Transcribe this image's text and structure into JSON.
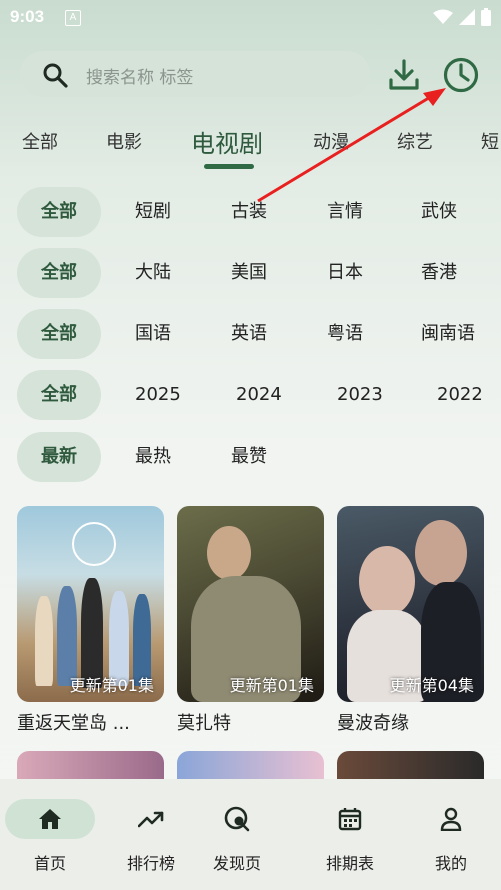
{
  "status_bar": {
    "time": "9:03",
    "notif_letter": "A"
  },
  "search": {
    "placeholder": "搜索名称 标签"
  },
  "icons": {
    "search": "search-icon",
    "download": "download-icon",
    "history": "clock-icon",
    "home": "home-icon",
    "ranking": "trending-icon",
    "discover": "discover-icon",
    "schedule": "calendar-icon",
    "profile": "person-icon"
  },
  "colors": {
    "accent": "#2f5a3e",
    "chip_bg": "#d6e3d9",
    "annotation_arrow": "#e8201f"
  },
  "tabs": [
    {
      "label": "全部"
    },
    {
      "label": "电影"
    },
    {
      "label": "电视剧"
    },
    {
      "label": "动漫"
    },
    {
      "label": "综艺"
    },
    {
      "label": "短"
    }
  ],
  "filters": [
    {
      "chip": "全部",
      "options": [
        "短剧",
        "古装",
        "言情",
        "武侠"
      ]
    },
    {
      "chip": "全部",
      "options": [
        "大陆",
        "美国",
        "日本",
        "香港"
      ]
    },
    {
      "chip": "全部",
      "options": [
        "国语",
        "英语",
        "粤语",
        "闽南语"
      ]
    },
    {
      "chip": "全部",
      "options": [
        "2025",
        "2024",
        "2023",
        "2022"
      ]
    },
    {
      "chip": "最新",
      "options": [
        "最热",
        "最赞"
      ]
    }
  ],
  "cards": [
    {
      "title": "重返天堂岛 ...",
      "badge": "更新第01集"
    },
    {
      "title": "莫扎特",
      "badge": "更新第01集"
    },
    {
      "title": "曼波奇缘",
      "badge": "更新第04集"
    }
  ],
  "nav": [
    {
      "label": "首页"
    },
    {
      "label": "排行榜"
    },
    {
      "label": "发现页"
    },
    {
      "label": "排期表"
    },
    {
      "label": "我的"
    }
  ]
}
